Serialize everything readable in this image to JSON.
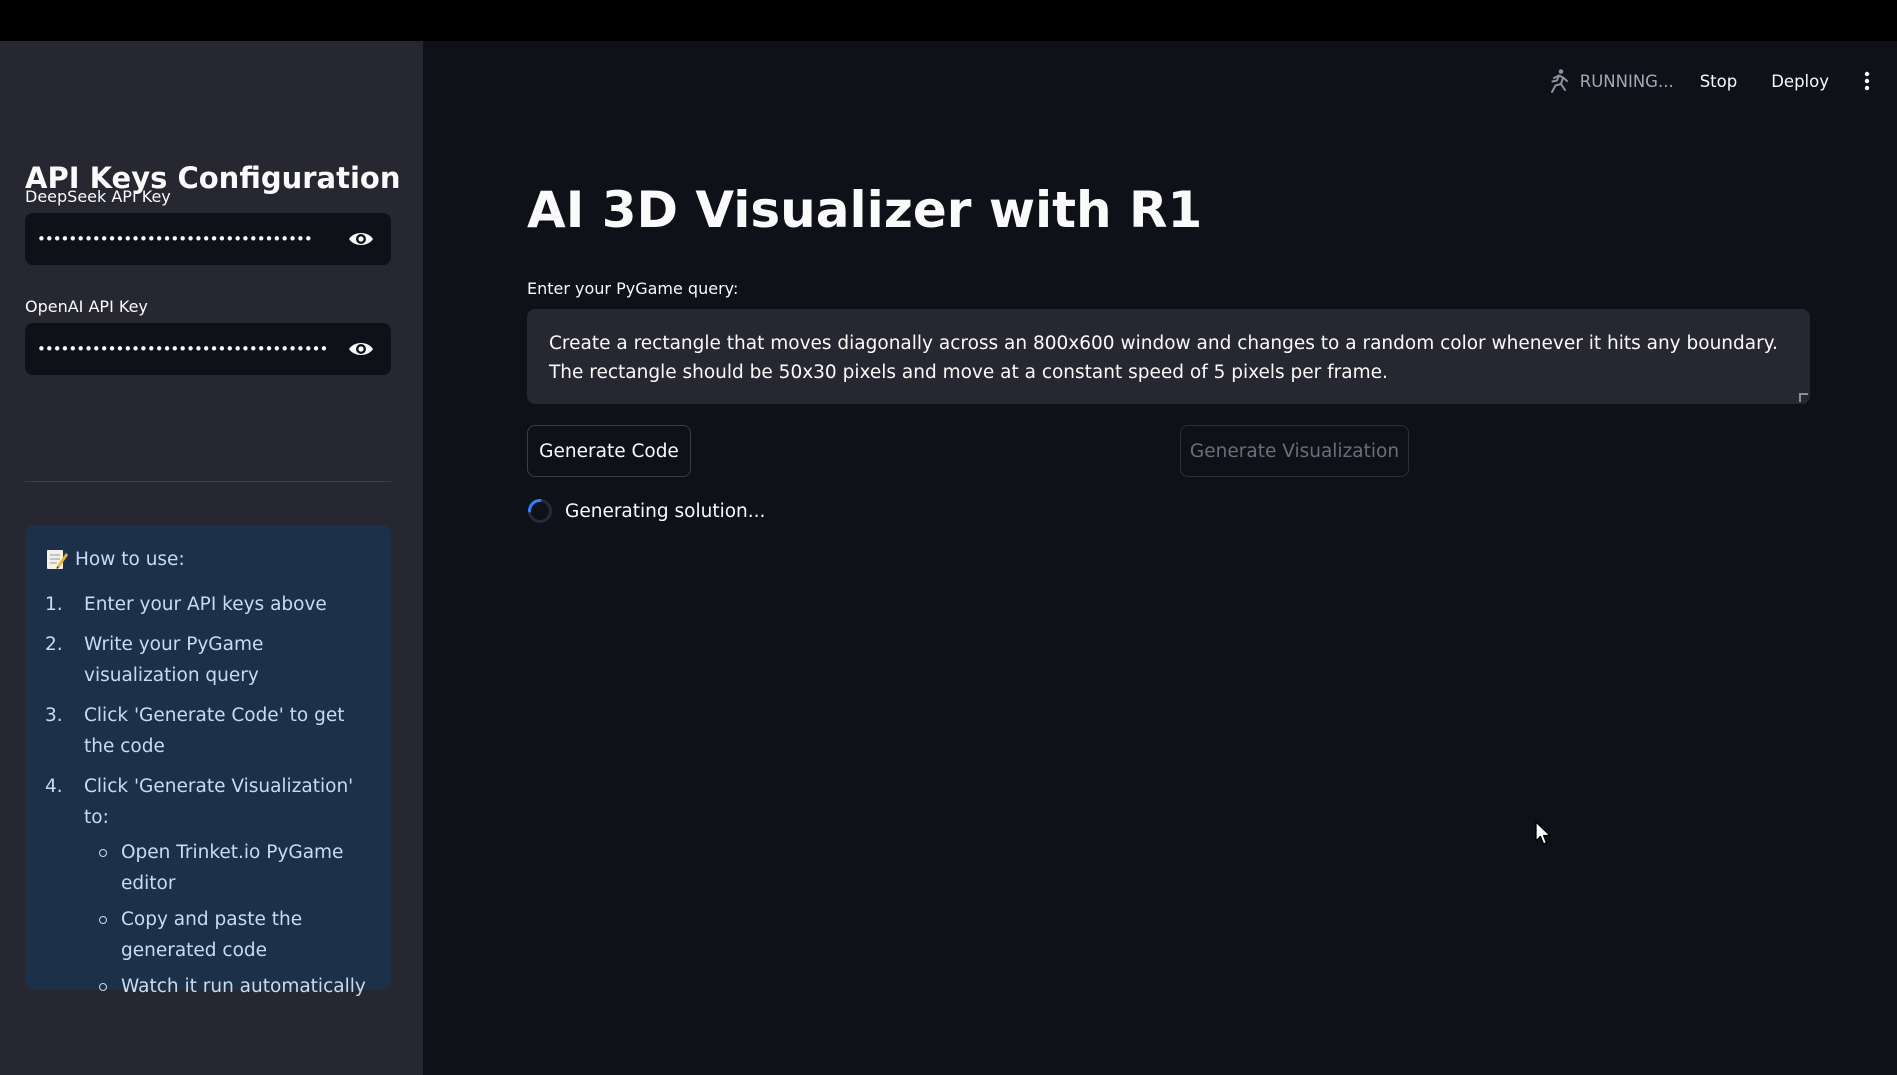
{
  "topbar": {
    "status_text": "RUNNING...",
    "stop_label": "Stop",
    "deploy_label": "Deploy",
    "status_icon": "running-figure-icon",
    "menu_icon": "kebab-menu-icon"
  },
  "sidebar": {
    "title": "API Keys Configuration",
    "deepseek": {
      "label": "DeepSeek API Key",
      "masked_value": "•••••••••••••••••••••••••••••••••••",
      "toggle_icon": "eye-icon"
    },
    "openai": {
      "label": "OpenAI API Key",
      "masked_value": "•••••••••••••••••••••••••••••••••••••••••••",
      "toggle_icon": "eye-icon"
    },
    "howto": {
      "icon": "memo-icon",
      "heading": "How to use:",
      "steps": [
        {
          "num": "1.",
          "text": "Enter your API keys above"
        },
        {
          "num": "2.",
          "text": "Write your PyGame visualization query"
        },
        {
          "num": "3.",
          "text": "Click 'Generate Code' to get the code"
        },
        {
          "num": "4.",
          "text": "Click 'Generate Visualization' to:"
        }
      ],
      "substeps": [
        "Open Trinket.io PyGame editor",
        "Copy and paste the generated code",
        "Watch it run automatically"
      ]
    }
  },
  "main": {
    "title": "AI 3D Visualizer with R1",
    "query_label": "Enter your PyGame query:",
    "query_value": "Create a rectangle that moves diagonally across an 800x600 window and changes to a random color whenever it hits any boundary. The rectangle should be 50x30 pixels and move at a constant speed of 5 pixels per frame.",
    "generate_code_label": "Generate Code",
    "generate_vis_label": "Generate Visualization",
    "status_text": "Generating solution...",
    "spinner_icon": "spinner-icon"
  },
  "colors": {
    "sidebar_bg": "#262730",
    "main_bg": "#0e1117",
    "info_bg": "#1c3049",
    "text": "#fafafa"
  }
}
